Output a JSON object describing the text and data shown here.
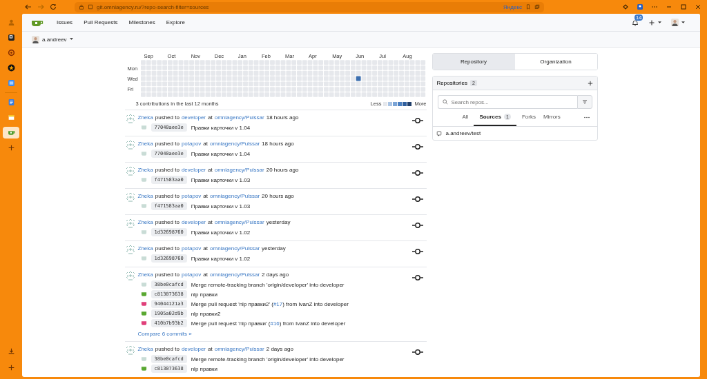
{
  "browser": {
    "url": "git.omniagency.ru/?repo-search-filter=sources",
    "search_badge": "Яндекс"
  },
  "sidebar": [
    {
      "kind": "user",
      "selected": false
    },
    {
      "kind": "square",
      "selected": false
    },
    {
      "kind": "ring",
      "selected": false
    },
    {
      "kind": "star",
      "selected": false
    },
    {
      "kind": "tile",
      "selected": false
    },
    {
      "kind": "doc",
      "selected": false
    },
    {
      "kind": "mail",
      "selected": false
    },
    {
      "kind": "gitea",
      "selected": true
    },
    {
      "kind": "plus",
      "selected": false
    }
  ],
  "nav": {
    "items": [
      "Issues",
      "Pull Requests",
      "Milestones",
      "Explore"
    ],
    "notifications": "14"
  },
  "user": {
    "name": "a.andreev"
  },
  "heatmap": {
    "months": [
      "Sep",
      "Oct",
      "Nov",
      "Dec",
      "Jan",
      "Feb",
      "Mar",
      "Apr",
      "May",
      "Jun",
      "Jul",
      "Aug"
    ],
    "days": [
      "Mon",
      "Wed",
      "Fri"
    ],
    "summary": "3 contributions in the last 12 months",
    "less": "Less",
    "more": "More"
  },
  "feed": [
    {
      "actor": "Zheka",
      "action": "pushed to",
      "branch": "developer",
      "at": "at",
      "repo": "omniagency/Pulssar",
      "time": "18 hours ago",
      "commits": [
        {
          "sha": "77040aee3e",
          "color": "#c9dcd6",
          "message": "Правки карточки v 1.04"
        }
      ]
    },
    {
      "actor": "Zheka",
      "action": "pushed to",
      "branch": "potapov",
      "at": "at",
      "repo": "omniagency/Pulssar",
      "time": "18 hours ago",
      "commits": [
        {
          "sha": "77040aee3e",
          "color": "#c9dcd6",
          "message": "Правки карточки v 1.04"
        }
      ]
    },
    {
      "actor": "Zheka",
      "action": "pushed to",
      "branch": "developer",
      "at": "at",
      "repo": "omniagency/Pulssar",
      "time": "20 hours ago",
      "commits": [
        {
          "sha": "f471583aa0",
          "color": "#c9dcd6",
          "message": "Правки карточки v 1.03"
        }
      ]
    },
    {
      "actor": "Zheka",
      "action": "pushed to",
      "branch": "potapov",
      "at": "at",
      "repo": "omniagency/Pulssar",
      "time": "20 hours ago",
      "commits": [
        {
          "sha": "f471583aa0",
          "color": "#c9dcd6",
          "message": "Правки карточки v 1.03"
        }
      ]
    },
    {
      "actor": "Zheka",
      "action": "pushed to",
      "branch": "developer",
      "at": "at",
      "repo": "omniagency/Pulssar",
      "time": "yesterday",
      "commits": [
        {
          "sha": "1d32698760",
          "color": "#c9dcd6",
          "message": "Правки карточки v 1.02"
        }
      ]
    },
    {
      "actor": "Zheka",
      "action": "pushed to",
      "branch": "potapov",
      "at": "at",
      "repo": "omniagency/Pulssar",
      "time": "yesterday",
      "commits": [
        {
          "sha": "1d32698760",
          "color": "#c9dcd6",
          "message": "Правки карточки v 1.02"
        }
      ]
    },
    {
      "actor": "Zheka",
      "action": "pushed to",
      "branch": "potapov",
      "at": "at",
      "repo": "omniagency/Pulssar",
      "time": "2 days ago",
      "commits": [
        {
          "sha": "38be0cafcd",
          "color": "#c9dcd6",
          "message": "Merge remote-tracking branch 'origin/developer' into developer"
        },
        {
          "sha": "c813073638",
          "color": "#5aa832",
          "message": "nlp правки"
        },
        {
          "sha": "94044121a3",
          "color": "#e0407a",
          "message": "Merge pull request 'nlp правки2' (",
          "pr_link": "#17",
          "message_end": ") from IvanZ into developer"
        },
        {
          "sha": "1905a02d9b",
          "color": "#5aa832",
          "message": "nlp правки2"
        },
        {
          "sha": "410b7b93b2",
          "color": "#e0407a",
          "message": "Merge pull request 'nlp правки' (",
          "pr_link": "#16",
          "message_end": ") from IvanZ into developer"
        }
      ],
      "compare": "Compare 6 commits »"
    },
    {
      "actor": "Zheka",
      "action": "pushed to",
      "branch": "developer",
      "at": "at",
      "repo": "omniagency/Pulssar",
      "time": "2 days ago",
      "commits": [
        {
          "sha": "38be0cafcd",
          "color": "#c9dcd6",
          "message": "Merge remote-tracking branch 'origin/developer' into developer"
        },
        {
          "sha": "c813073638",
          "color": "#5aa832",
          "message": "nlp правки"
        }
      ]
    }
  ],
  "right": {
    "tabs": [
      {
        "label": "Repository",
        "selected": true
      },
      {
        "label": "Organization",
        "selected": false
      }
    ],
    "title": "Repositories",
    "count": "2",
    "search_placeholder": "Search repos...",
    "filters": [
      {
        "label": "All",
        "selected": false
      },
      {
        "label": "Sources",
        "count": "1",
        "selected": true
      },
      {
        "label": "Forks",
        "selected": false
      },
      {
        "label": "Mirrors",
        "selected": false
      }
    ],
    "repos": [
      "a.andreev/test"
    ]
  }
}
